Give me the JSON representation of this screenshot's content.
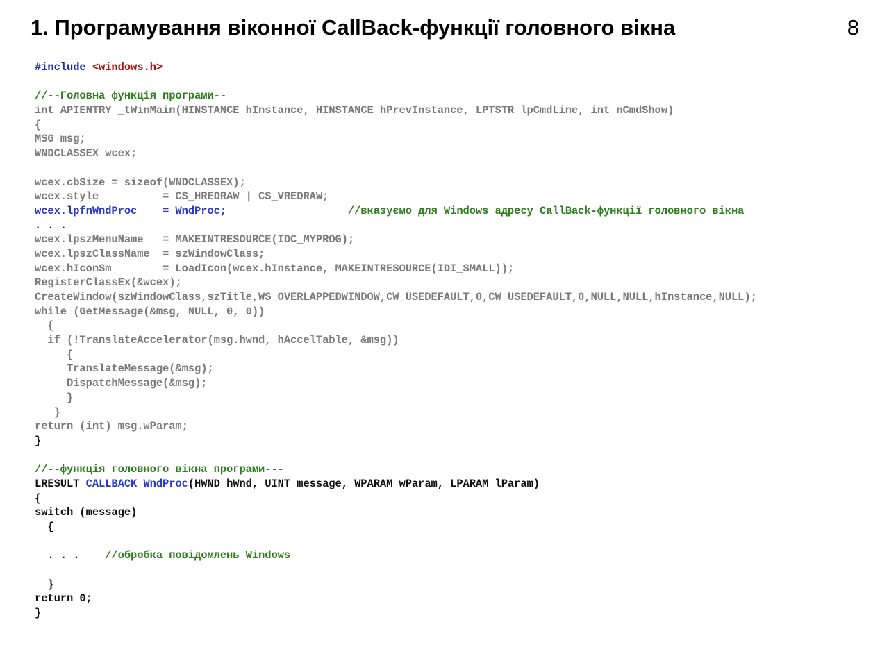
{
  "slide": {
    "title": "1. Програмування віконної CallBack-функції головного вікна",
    "number": "8"
  },
  "code": {
    "include_kw": "#include ",
    "include_file": "<windows.h>",
    "comment_main": "//--Головна функція програми--",
    "winmain_sig": "int APIENTRY _tWinMain(HINSTANCE hInstance, HINSTANCE hPrevInstance, LPTSTR lpCmdLine, int nCmdShow)",
    "open_brace_1": "{",
    "msg_decl": "MSG msg;",
    "wcex_decl": "WNDCLASSEX wcex;",
    "cbsize": "wcex.cbSize = sizeof(WNDCLASSEX);",
    "style": "wcex.style          = CS_HREDRAW | CS_VREDRAW;",
    "wndproc_assign": "wcex.lpfnWndProc    = WndProc;",
    "wndproc_comment": "//вказуємо для Windows адресу CallBack-функції головного вікна",
    "ellipsis_1": ". . .",
    "menuname": "wcex.lpszMenuName   = MAKEINTRESOURCE(IDC_MYPROG);",
    "classname": "wcex.lpszClassName  = szWindowClass;",
    "iconsm": "wcex.hIconSm        = LoadIcon(wcex.hInstance, MAKEINTRESOURCE(IDI_SMALL));",
    "register": "RegisterClassEx(&wcex);",
    "createwindow": "CreateWindow(szWindowClass,szTitle,WS_OVERLAPPEDWINDOW,CW_USEDEFAULT,0,CW_USEDEFAULT,0,NULL,NULL,hInstance,NULL);",
    "while_line": "while (GetMessage(&msg, NULL, 0, 0))",
    "while_open": "  {",
    "if_line": "  if (!TranslateAccelerator(msg.hwnd, hAccelTable, &msg))",
    "if_open": "     {",
    "translate": "     TranslateMessage(&msg);",
    "dispatch": "     DispatchMessage(&msg);",
    "if_close": "     }",
    "while_close": "   }",
    "return_main": "return (int) msg.wParam;",
    "close_brace_1": "}",
    "comment_wndproc": "//--функція головного вікна програми---",
    "lresult": "LRESULT ",
    "callback_kw": "CALLBACK WndProc",
    "wndproc_params": "(HWND hWnd, UINT message, WPARAM wParam, LPARAM lParam)",
    "open_brace_2": "{",
    "switch_line": "switch (message)",
    "switch_open": "  {",
    "ellipsis_2": "  . . .    ",
    "msg_comment": "//обробка повідомлень Windows",
    "switch_close": "  }",
    "return_zero": "return 0;",
    "close_brace_2": "}"
  },
  "colors": {
    "code_gray": "#7a7a7a",
    "keyword_blue": "#1d2bb0",
    "comment_green": "#2e7d1f",
    "include_red": "#a11515"
  }
}
